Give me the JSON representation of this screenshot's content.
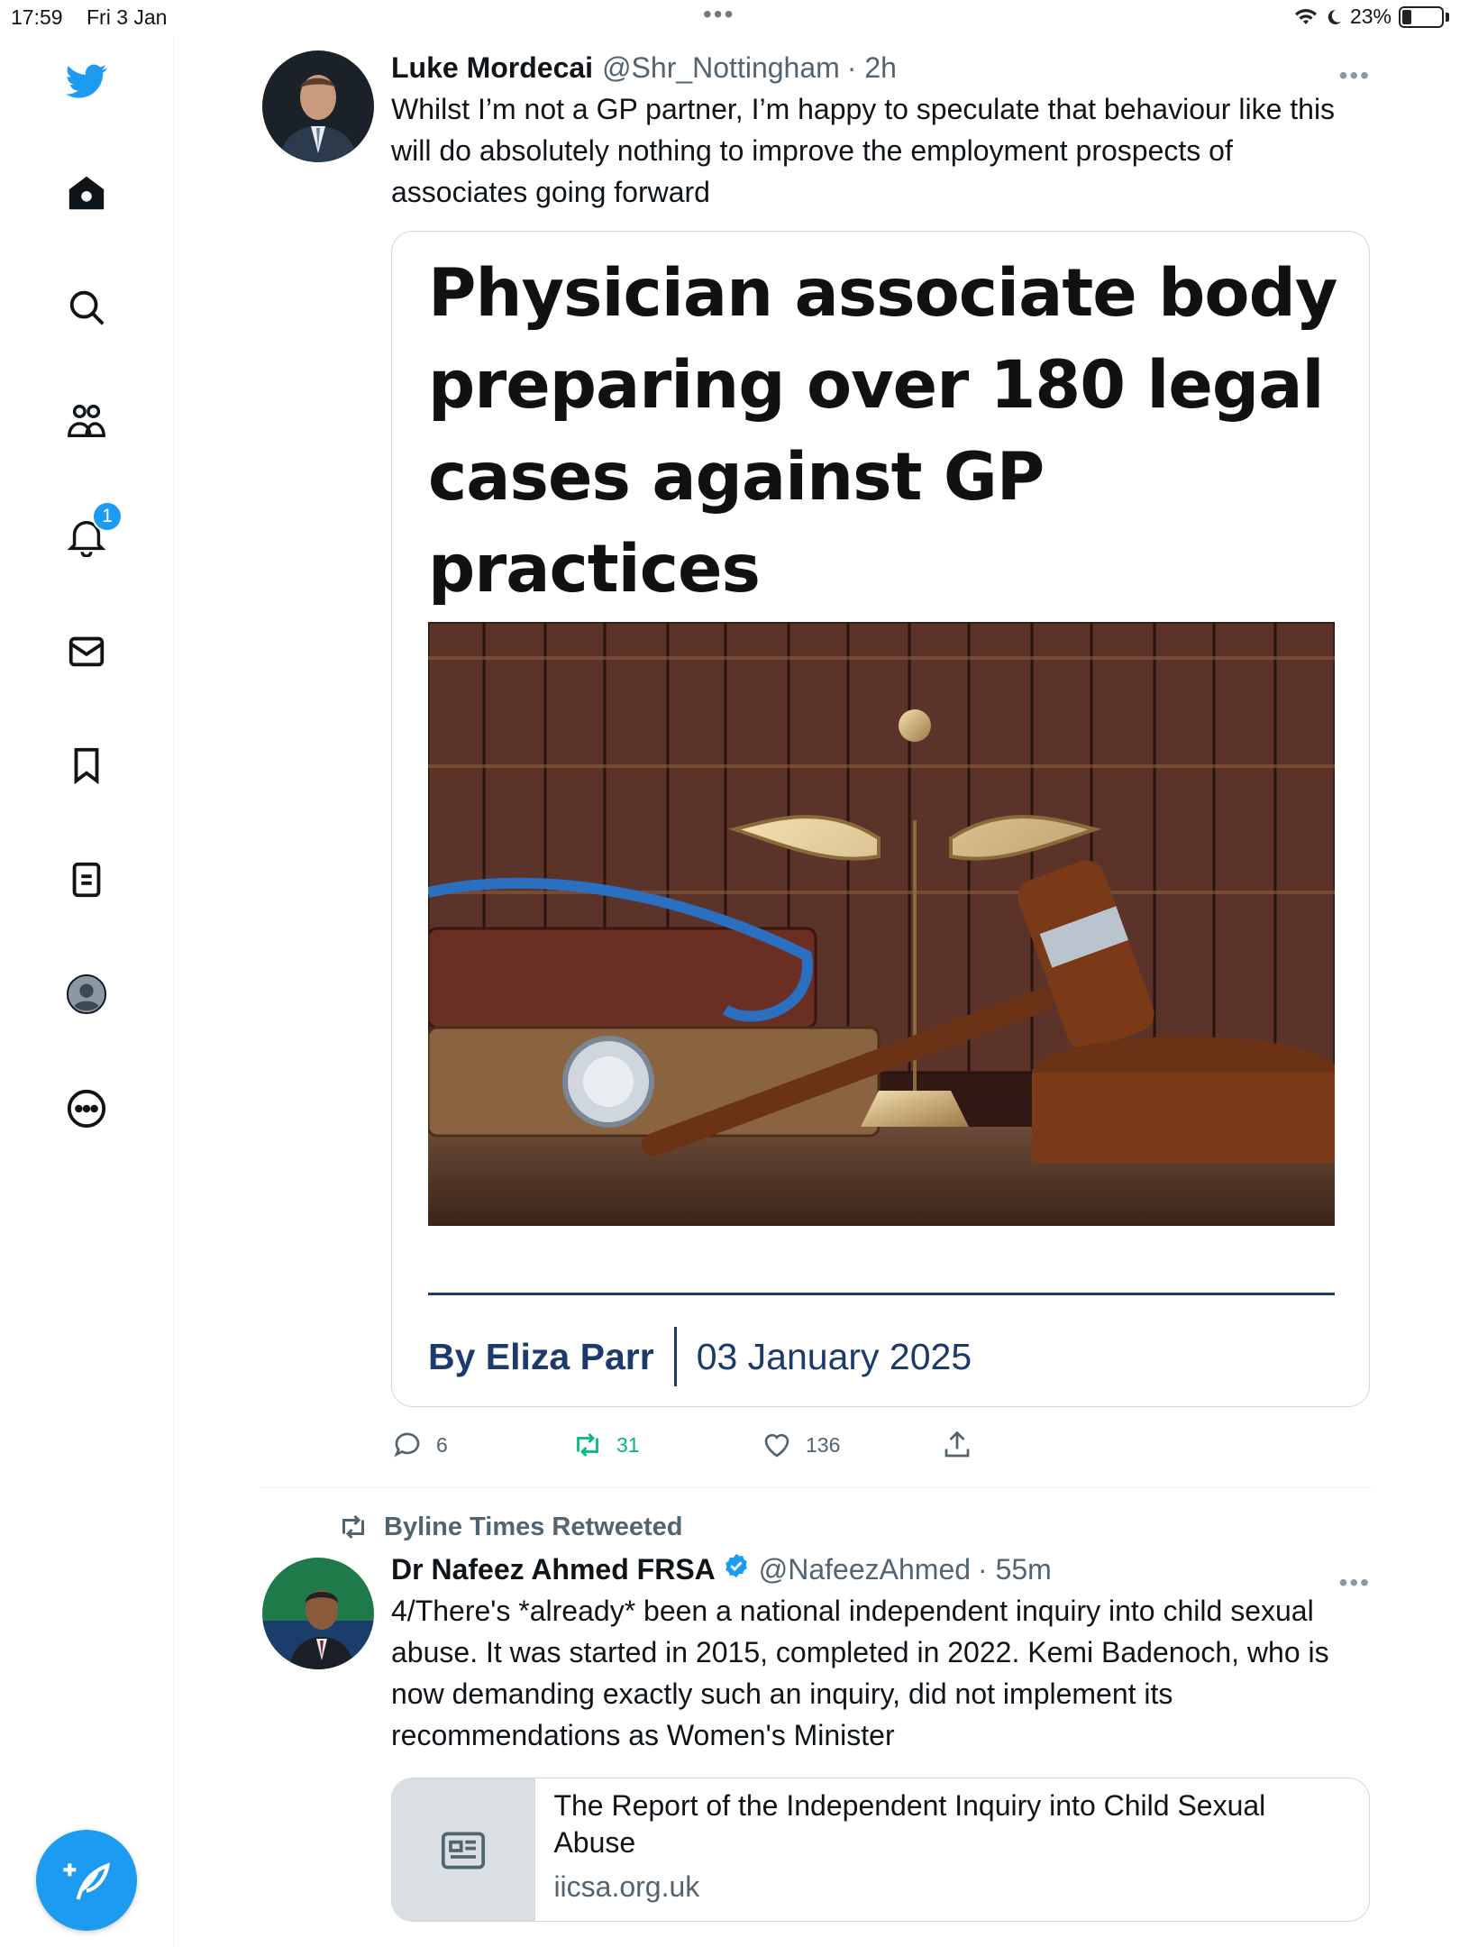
{
  "status": {
    "time": "17:59",
    "date": "Fri 3 Jan",
    "battery": "23%",
    "battery_level": 0.23
  },
  "sidebar": {
    "notification_count": "1",
    "items": [
      "twitter-logo",
      "home",
      "search",
      "communities",
      "notifications",
      "messages",
      "bookmarks",
      "lists",
      "profile",
      "more"
    ]
  },
  "tweets": [
    {
      "author": "Luke Mordecai",
      "handle": "@Shr_Nottingham",
      "time": "· 2h",
      "text": "Whilst I’m not a GP partner, I’m happy to speculate that behaviour like this will do absolutely nothing to improve the employment prospects of associates going forward",
      "card": {
        "headline": "Physician associate body preparing over 180 legal cases against GP practices",
        "byline": "By Eliza Parr",
        "date": "03 January 2025"
      },
      "replies": "6",
      "retweets": "31",
      "likes": "136"
    },
    {
      "retweeted_by": "Byline Times Retweeted",
      "author": "Dr Nafeez Ahmed FRSA",
      "handle": "@NafeezAhmed",
      "time": "· 55m",
      "text": "4/There's *already* been a national independent inquiry into child sexual abuse. It was started in 2015, completed in 2022. Kemi Badenoch, who is now demanding exactly such an inquiry, did not implement its recommendations as Women's Minister",
      "link_card": {
        "title": "The Report of the Independent Inquiry into Child Sexual Abuse",
        "domain": "iicsa.org.uk"
      }
    }
  ],
  "colors": {
    "accent": "#1d9bf0",
    "retweet_green": "#00ba7c",
    "byline_navy": "#1c3a6b"
  }
}
